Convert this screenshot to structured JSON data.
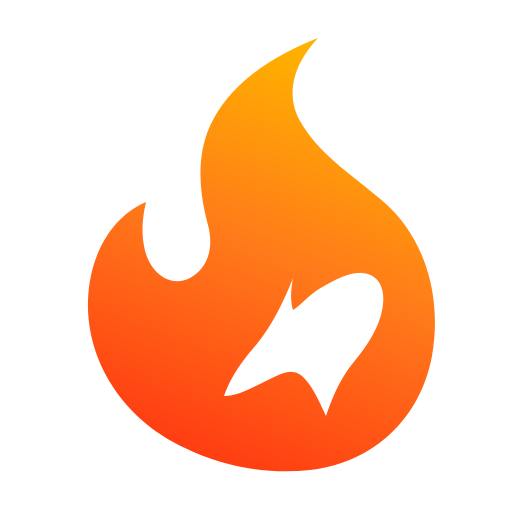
{
  "logo": {
    "icon": "flame-icon",
    "inner_mark_icon": "lightning-bolt-icon",
    "colors": {
      "background": "#ffffff",
      "gradient_top": "#ffb000",
      "gradient_mid": "#ff7a1a",
      "gradient_bottom": "#ff3d12",
      "inner_mark": "#ffffff"
    }
  }
}
